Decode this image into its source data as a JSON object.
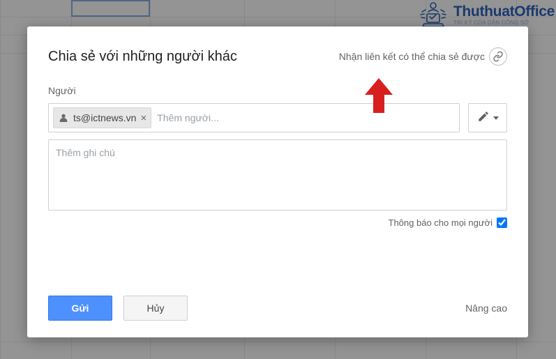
{
  "logo": {
    "main": "ThuthuatOffice",
    "sub": "TRI KỶ CỦA DÂN CÔNG SỞ"
  },
  "modal": {
    "title": "Chia sẻ với những người khác",
    "shareable_link": "Nhận liên kết có thể chia sẻ được",
    "people_label": "Người",
    "chip_email": "ts@ictnews.vn",
    "add_people_placeholder": "Thêm người...",
    "note_placeholder": "Thêm ghi chú",
    "notify_label": "Thông báo cho mọi người",
    "send_label": "Gửi",
    "cancel_label": "Hủy",
    "advanced_label": "Nâng cao"
  }
}
